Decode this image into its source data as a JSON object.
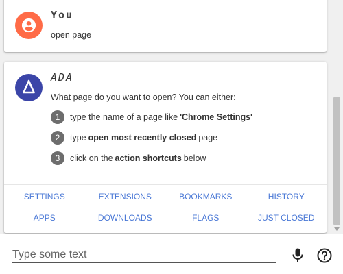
{
  "messages": {
    "user": {
      "sender": "You",
      "text": "open page",
      "avatar_icon": "person-circle-icon",
      "avatar_color": "#ff6b47"
    },
    "bot": {
      "sender": "ADA",
      "text": "What page do you want to open? You can either:",
      "avatar_icon": "ada-logo-icon",
      "avatar_color": "#3b45a8",
      "steps": [
        {
          "num": "1",
          "before": "type the name of a page like",
          "bold": "'Chrome Settings'",
          "after": ""
        },
        {
          "num": "2",
          "before": "type",
          "bold": "open most recently closed",
          "after": "page"
        },
        {
          "num": "3",
          "before": "click on the",
          "bold": "action shortcuts",
          "after": "below"
        }
      ],
      "shortcuts": [
        "SETTINGS",
        "EXTENSIONS",
        "BOOKMARKS",
        "HISTORY",
        "APPS",
        "DOWNLOADS",
        "FLAGS",
        "JUST CLOSED"
      ]
    }
  },
  "input": {
    "placeholder": "Type some text",
    "value": ""
  },
  "icons": {
    "mic": "microphone-icon",
    "help": "help-circle-icon"
  },
  "colors": {
    "link": "#4a78d6",
    "step_badge": "#6d6d6d"
  }
}
